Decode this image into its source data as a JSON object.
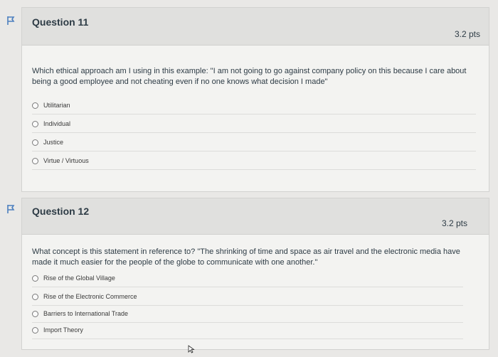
{
  "questions": [
    {
      "title": "Question 11",
      "points": "3.2 pts",
      "text": "Which ethical approach am I using in this example: \"I am not going to go against company policy on this because I care about being a good employee and not cheating even if no one knows what decision I made\"",
      "answers": [
        "Utilitarian",
        "Individual",
        "Justice",
        "Virtue / Virtuous"
      ]
    },
    {
      "title": "Question 12",
      "points": "3.2 pts",
      "text": "What concept is this statement in reference to? \"The shrinking of time and space as air travel and the electronic media have made it much easier for the people of the globe to communicate with one another.\"",
      "answers": [
        "Rise of the Global Village",
        "Rise of the Electronic Commerce",
        "Barriers to International Trade",
        "Import Theory"
      ]
    }
  ],
  "icons": {
    "flag": "flag-icon",
    "radio": "radio-button-icon",
    "cursor": "mouse-cursor-icon"
  },
  "colors": {
    "flag": "#4c7fbf",
    "header_bg": "#e0e0de",
    "card_bg": "#f3f3f1",
    "page_bg": "#e9e8e6"
  }
}
